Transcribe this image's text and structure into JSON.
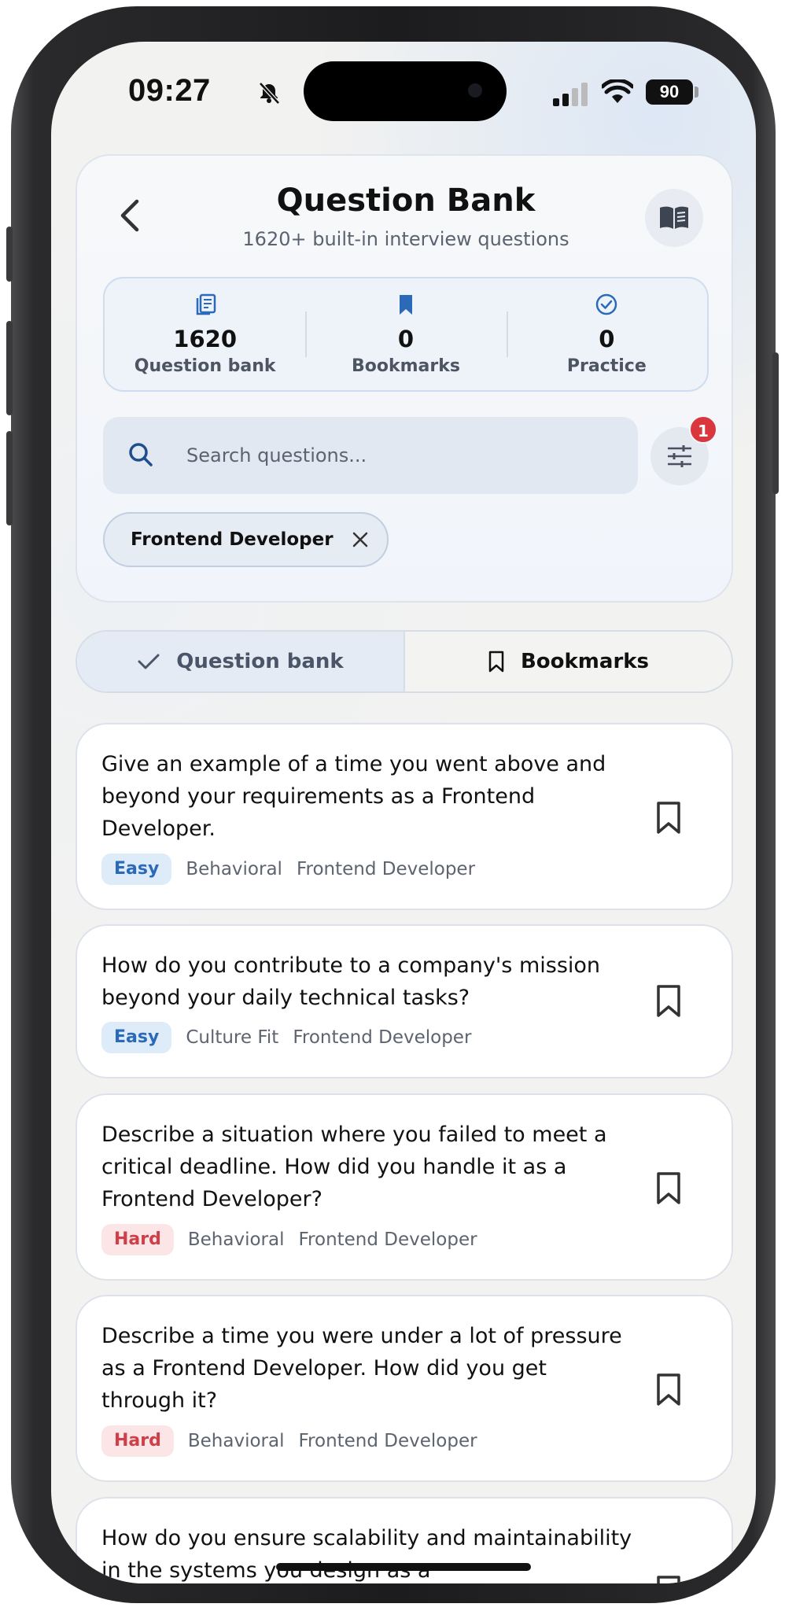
{
  "status_bar": {
    "time": "09:27",
    "battery": "90"
  },
  "header": {
    "title": "Question Bank",
    "subtitle": "1620+ built-in interview questions"
  },
  "stats": [
    {
      "icon": "document-stack-icon",
      "value": "1620",
      "label": "Question bank"
    },
    {
      "icon": "bookmark-filled-icon",
      "value": "0",
      "label": "Bookmarks"
    },
    {
      "icon": "check-circle-icon",
      "value": "0",
      "label": "Practice"
    }
  ],
  "search": {
    "placeholder": "Search questions...",
    "value": ""
  },
  "filter": {
    "badge_count": "1"
  },
  "active_filter_chip": {
    "label": "Frontend Developer"
  },
  "tabs": [
    {
      "label": "Question bank",
      "active": true
    },
    {
      "label": "Bookmarks",
      "active": false
    }
  ],
  "questions": [
    {
      "text": "Give an example of a time you went above and beyond your requirements as a Frontend Developer.",
      "difficulty": "Easy",
      "category": "Behavioral",
      "role": "Frontend Developer"
    },
    {
      "text": "How do you contribute to a company's mission beyond your daily technical tasks?",
      "difficulty": "Easy",
      "category": "Culture Fit",
      "role": "Frontend Developer"
    },
    {
      "text": "Describe a situation where you failed to meet a critical deadline. How did you handle it as a Frontend Developer?",
      "difficulty": "Hard",
      "category": "Behavioral",
      "role": "Frontend Developer"
    },
    {
      "text": "Describe a time you were under a lot of pressure as a Frontend Developer. How did you get through it?",
      "difficulty": "Hard",
      "category": "Behavioral",
      "role": "Frontend Developer"
    },
    {
      "text": "How do you ensure scalability and maintainability in the systems you design as a"
    }
  ],
  "colors": {
    "accent": "#2a6ab8",
    "easy": "#2a6ab8",
    "hard": "#cf3f48",
    "badge": "#d9363e"
  }
}
